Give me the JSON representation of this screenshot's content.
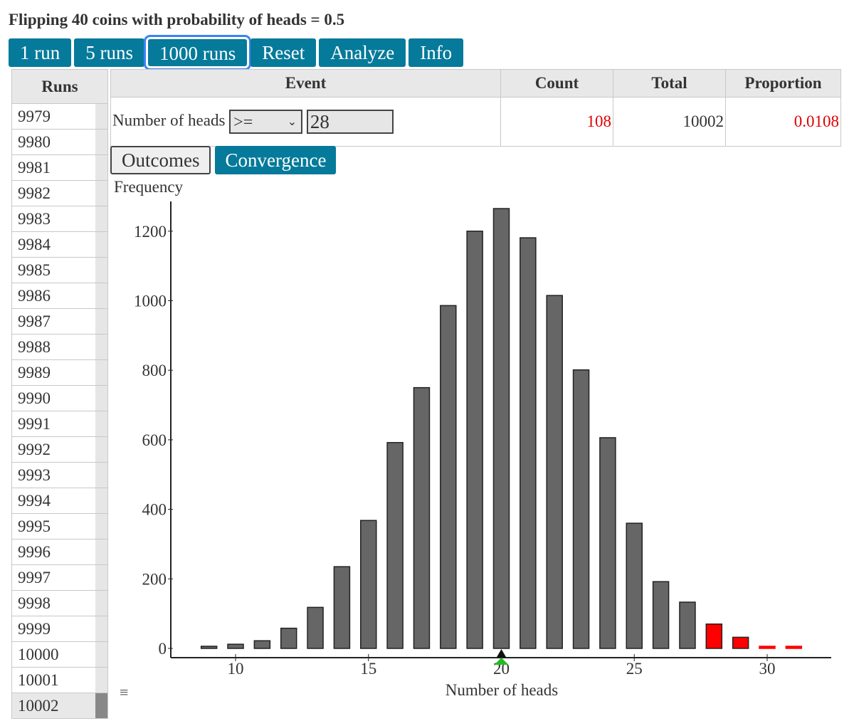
{
  "title": "Flipping 40 coins with probability of heads = 0.5",
  "toolbar": {
    "buttons": [
      "1 run",
      "5 runs",
      "1000 runs",
      "Reset",
      "Analyze",
      "Info"
    ],
    "focused": "1000 runs"
  },
  "runs": {
    "header": "Runs",
    "rows": [
      "9979",
      "9980",
      "9981",
      "9982",
      "9983",
      "9984",
      "9985",
      "9986",
      "9987",
      "9988",
      "9989",
      "9990",
      "9991",
      "9992",
      "9993",
      "9994",
      "9995",
      "9996",
      "9997",
      "9998",
      "9999",
      "10000",
      "10001",
      "10002"
    ],
    "menu_icon": "≡"
  },
  "event": {
    "headers": [
      "Event",
      "Count",
      "Total",
      "Proportion"
    ],
    "label": "Number of heads",
    "operator": ">=",
    "value": "28",
    "count": "108",
    "total": "10002",
    "proportion": "0.0108"
  },
  "tabs": [
    "Outcomes",
    "Convergence"
  ],
  "colors": {
    "accent": "#067a9a",
    "bar": "#666666",
    "highlight": "#ff0000",
    "mean_marker": "#22bb22"
  },
  "chart_data": {
    "type": "bar",
    "title": "",
    "xlabel": "Number of heads",
    "ylabel": "Frequency",
    "x": [
      9,
      10,
      11,
      12,
      13,
      14,
      15,
      16,
      17,
      18,
      19,
      20,
      21,
      22,
      23,
      24,
      25,
      26,
      27,
      28,
      29,
      30,
      31
    ],
    "values": [
      2,
      12,
      22,
      58,
      118,
      235,
      368,
      592,
      750,
      986,
      1200,
      1265,
      1181,
      1015,
      801,
      606,
      360,
      192,
      133,
      70,
      32,
      5,
      1
    ],
    "highlight_from": 28,
    "xticks": [
      10,
      15,
      20,
      25,
      30
    ],
    "yticks": [
      0,
      200,
      400,
      600,
      800,
      1000,
      1200
    ],
    "xlim": [
      7,
      33
    ],
    "ylim": [
      0,
      1300
    ],
    "mean_marker": 20,
    "grid": false
  }
}
